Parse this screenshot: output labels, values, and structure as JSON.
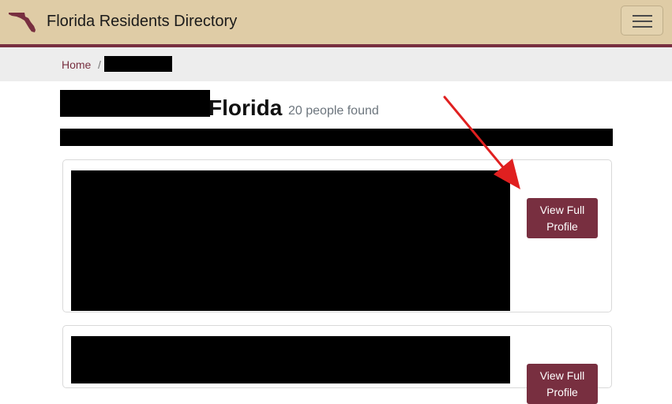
{
  "navbar": {
    "title": "Florida Residents Directory",
    "logo_icon": "florida-state-shape-icon",
    "menu_icon": "hamburger-menu-icon",
    "background_color": "#dfcca6",
    "accent_color": "#782f40"
  },
  "breadcrumb": {
    "home_label": "Home",
    "separator": "/"
  },
  "results": {
    "title_suffix": "Florida",
    "count_text": "20 people found"
  },
  "cards": [
    {
      "button_label": "View Full Profile"
    },
    {
      "button_label": "View Full Profile"
    }
  ],
  "annotation": {
    "arrow_color": "#e02020",
    "arrow_icon": "red-arrow-icon"
  }
}
